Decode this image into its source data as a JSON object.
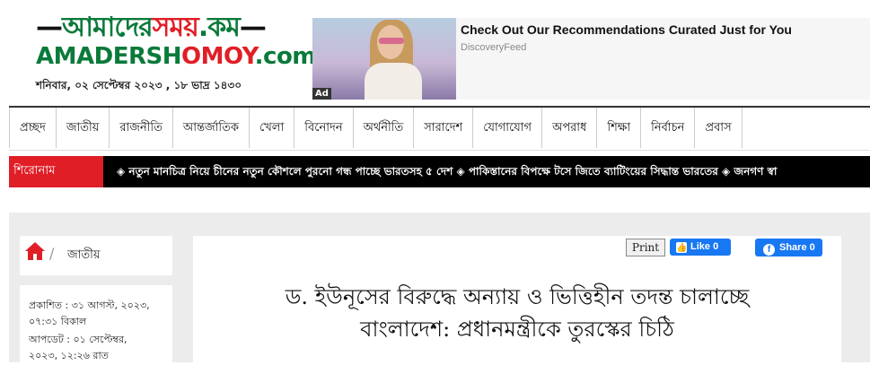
{
  "logo": {
    "top_green": "আমাদের",
    "top_red": "সময়",
    "top_suffix": ".কম",
    "bottom_green": "AMADERSH",
    "bottom_red": "OMOY",
    "bottom_suffix": ".com"
  },
  "header": {
    "date": "শনিবার, ০২ সেপ্টেম্বর ২০২৩ , ১৮ ভাদ্র ১৪৩০"
  },
  "ad": {
    "title": "Check Out Our Recommendations Curated Just for You",
    "source": "DiscoveryFeed",
    "tag": "Ad"
  },
  "nav": {
    "items": [
      "প্রচ্ছদ",
      "জাতীয়",
      "রাজনীতি",
      "আন্তর্জাতিক",
      "খেলা",
      "বিনোদন",
      "অর্থনীতি",
      "সারাদেশ",
      "যোগাযোগ",
      "অপরাধ",
      "শিক্ষা",
      "নির্বাচন",
      "প্রবাস"
    ]
  },
  "ticker": {
    "label": "শিরোনাম",
    "text": "◈ নতুন মানচিত্র নিয়ে চীনের নতুন কৌশলে পুরনো গন্ধ পাচ্ছে ভারতসহ ৫ দেশ ◈ পাকিস্তানের বিপক্ষে টসে জিতে ব্যাটিংয়ের সিদ্ধান্ত ভারতের ◈ জনগণ স্বা"
  },
  "breadcrumb": {
    "section": "জাতীয়"
  },
  "meta": {
    "published_line1": "প্রকাশিত : ৩১ আগস্ট, ২০২৩,",
    "published_line2": "০৭:৩১ বিকাল",
    "updated_line1": "আপডেট : ০১ সেপ্টেম্বর,",
    "updated_line2": "২০২৩, ১২:২৬ রাত"
  },
  "article": {
    "print_label": "Print",
    "like_label": "Like 0",
    "share_label": "Share 0",
    "headline_line1": "ড. ইউনূসের বিরুদ্ধে অন্যায় ও ভিত্তিহীন তদন্ত চালাচ্ছে",
    "headline_line2": "বাংলাদেশ: প্রধানমন্ত্রীকে তুরস্কের চিঠি"
  },
  "colors": {
    "brand_green": "#0a7a3a",
    "brand_red": "#e01e26",
    "facebook_blue": "#1877f2"
  }
}
